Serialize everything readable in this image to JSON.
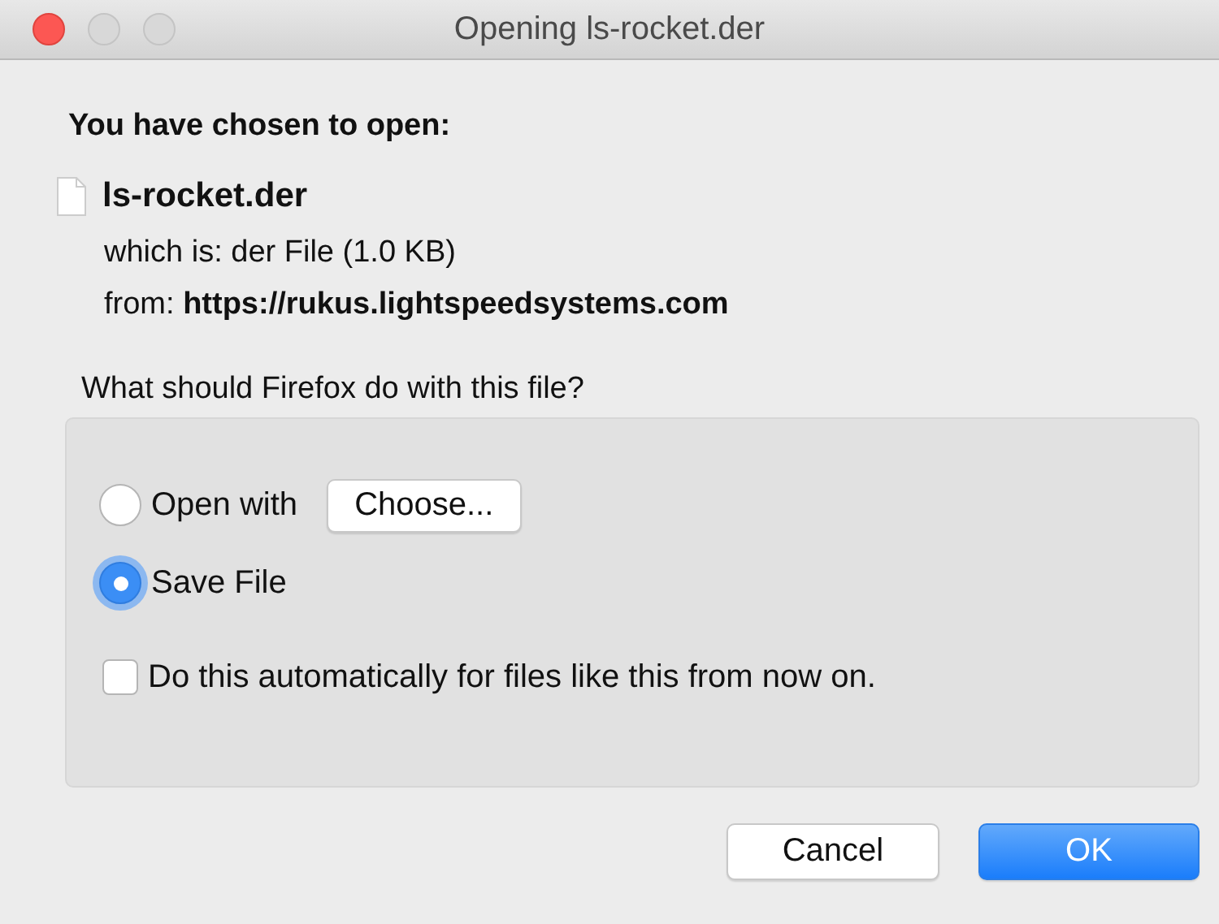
{
  "window": {
    "title": "Opening ls-rocket.der"
  },
  "heading": "You have chosen to open:",
  "file": {
    "name": "ls-rocket.der",
    "type_label": "which is:",
    "type": "der File (1.0 KB)",
    "from_label": "from:",
    "from": "https://rukus.lightspeedsystems.com"
  },
  "question": "What should Firefox do with this file?",
  "options": [
    {
      "kind": "radio",
      "label": "Open with",
      "selected": false,
      "button": "Choose..."
    },
    {
      "kind": "radio",
      "label": "Save File",
      "selected": true
    },
    {
      "kind": "checkbox",
      "label": "Do this automatically for files like this from now on.",
      "checked": false
    }
  ],
  "buttons": [
    {
      "label": "Cancel",
      "kind": "normal"
    },
    {
      "label": "OK",
      "kind": "default"
    }
  ]
}
